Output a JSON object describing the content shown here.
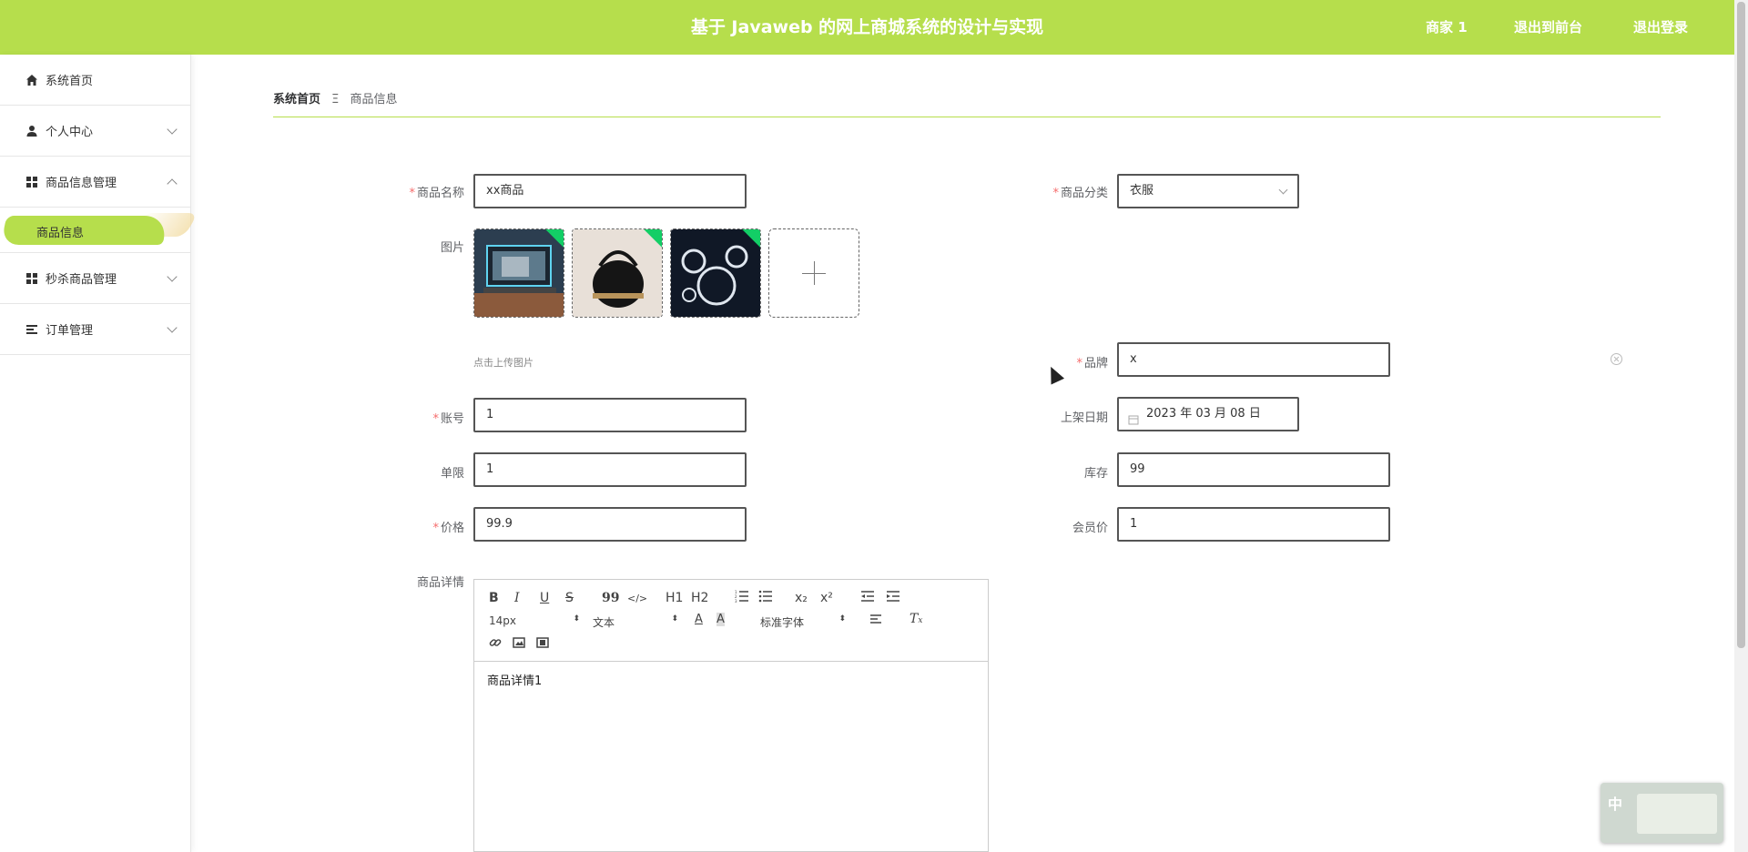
{
  "header": {
    "title": "基于 Javaweb 的网上商城系统的设计与实现",
    "user": "商家 1",
    "link_front": "退出到前台",
    "link_logout": "退出登录"
  },
  "sidebar": {
    "items": [
      {
        "label": "系统首页",
        "icon": "home-icon"
      },
      {
        "label": "个人中心",
        "icon": "user-icon"
      },
      {
        "label": "商品信息管理",
        "icon": "grid-icon"
      },
      {
        "label": "秒杀商品管理",
        "icon": "grid-icon"
      },
      {
        "label": "订单管理",
        "icon": "list-icon"
      }
    ],
    "submenu_active": "商品信息"
  },
  "breadcrumb": {
    "home": "系统首页",
    "separator": "Ξ",
    "current": "商品信息"
  },
  "form": {
    "name_label": "商品名称",
    "name_value": "xx商品",
    "category_label": "商品分类",
    "category_value": "衣服",
    "image_label": "图片",
    "upload_hint": "点击上传图片",
    "brand_label": "品牌",
    "brand_value": "x",
    "account_label": "账号",
    "account_value": "1",
    "date_label": "上架日期",
    "date_value": "2023 年 03 月 08 日",
    "limit_label": "单限",
    "limit_value": "1",
    "stock_label": "库存",
    "stock_value": "99",
    "price_label": "价格",
    "price_value": "99.9",
    "member_price_label": "会员价",
    "member_price_value": "1",
    "detail_label": "商品详情"
  },
  "editor": {
    "toolbar": {
      "bold": "B",
      "italic": "I",
      "underline": "U",
      "strike": "S",
      "quote": "99",
      "code": "</>",
      "h1": "H1",
      "h2": "H2",
      "sub": "x₂",
      "sup": "x²",
      "size": "14px",
      "text": "文本",
      "font": "标准字体"
    },
    "content": "商品详情1"
  },
  "widget": {
    "char": "中"
  },
  "colors": {
    "accent": "#b6de4c",
    "required": "#f56c6c",
    "upload_success": "#13ce66"
  }
}
